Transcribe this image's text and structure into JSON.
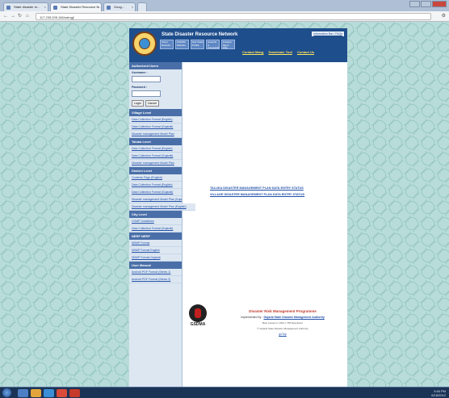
{
  "browser": {
    "tabs": [
      {
        "label": "State disaster re..."
      },
      {
        "label": "State Disaster Resource N..."
      },
      {
        "label": "Goog..."
      }
    ],
    "url": "117.239.205.166/sdrngj/"
  },
  "header": {
    "site_title": "State Disaster Resource Network",
    "top_link": "Information Bar / FAQs",
    "menu": [
      "About Network",
      "GSDMA Website",
      "Dist./Taluka Profile",
      "Hazards & Vulnerability",
      "Disaster Mgmt Plan"
    ],
    "sub_links": [
      "Contact Mang",
      "Download, Tool",
      "Contact Us"
    ]
  },
  "sidebar": {
    "heading": "Authorized Users",
    "username_label": "Username :",
    "password_label": "Password :",
    "login_button": "Login",
    "cancel_button": "Cancel",
    "village_heading": "Village Level",
    "village_links": [
      "Data Collection Format (English)",
      "Data Collection Format (Gujarati)",
      "Disaster management Model Plan"
    ],
    "taluka_heading": "Taluka Level",
    "taluka_links": [
      "Data Collection Format (English)",
      "Data Collection Format (Gujarati)",
      "Disaster management Model Plan"
    ],
    "district_heading": "District Level",
    "district_links": [
      "Contents Page (English)",
      "Data Collection Format (English)",
      "Data Collection Format (Gujarati)",
      "Disaster management Model Plan (Gujarati)"
    ],
    "district_link_wide": "Disaster management Model Plan (English)",
    "city_heading": "City Level",
    "city_links": [
      "CDMP Guidelines",
      "Data Collection Format (Gujarati)"
    ],
    "nerf_heading": "NERF NERF",
    "nerf_links": [
      "NDMP Format",
      "NDMP Format English",
      "NDMP Format Gujarati"
    ],
    "manual_heading": "User Manual",
    "manual_links": [
      "Android PDF Format (Series 1)",
      "Android PDF Format (Series 2)"
    ]
  },
  "content": {
    "status_links": [
      "TALUKA DISASTER MANAGEMENT PLAN DATA ENTRY STATUS",
      "VILLAGE DISASTER MANAGEMENT PLAN DATA ENTRY STATUS"
    ],
    "footer_logo_caption": "GSDMA",
    "footer_title": "Disaster Risk Management Programme",
    "footer_implemented_prefix": "Implemented By :",
    "footer_implemented_link": "Gujarat State Disaster Management Authority",
    "footer_visitor": "Best viewed in 1024 x 768 Resolution",
    "footer_copyright": "© Gujarat State Disaster Management Authority",
    "footer_link": "goTop"
  },
  "taskbar": {
    "clock": "3:46 PM",
    "date": "6/18/2012"
  },
  "colors": {
    "header_bg": "#1f4e8c",
    "accent_yellow": "#ffe45a",
    "link": "#2150a8",
    "footer_red": "#c0392b"
  }
}
